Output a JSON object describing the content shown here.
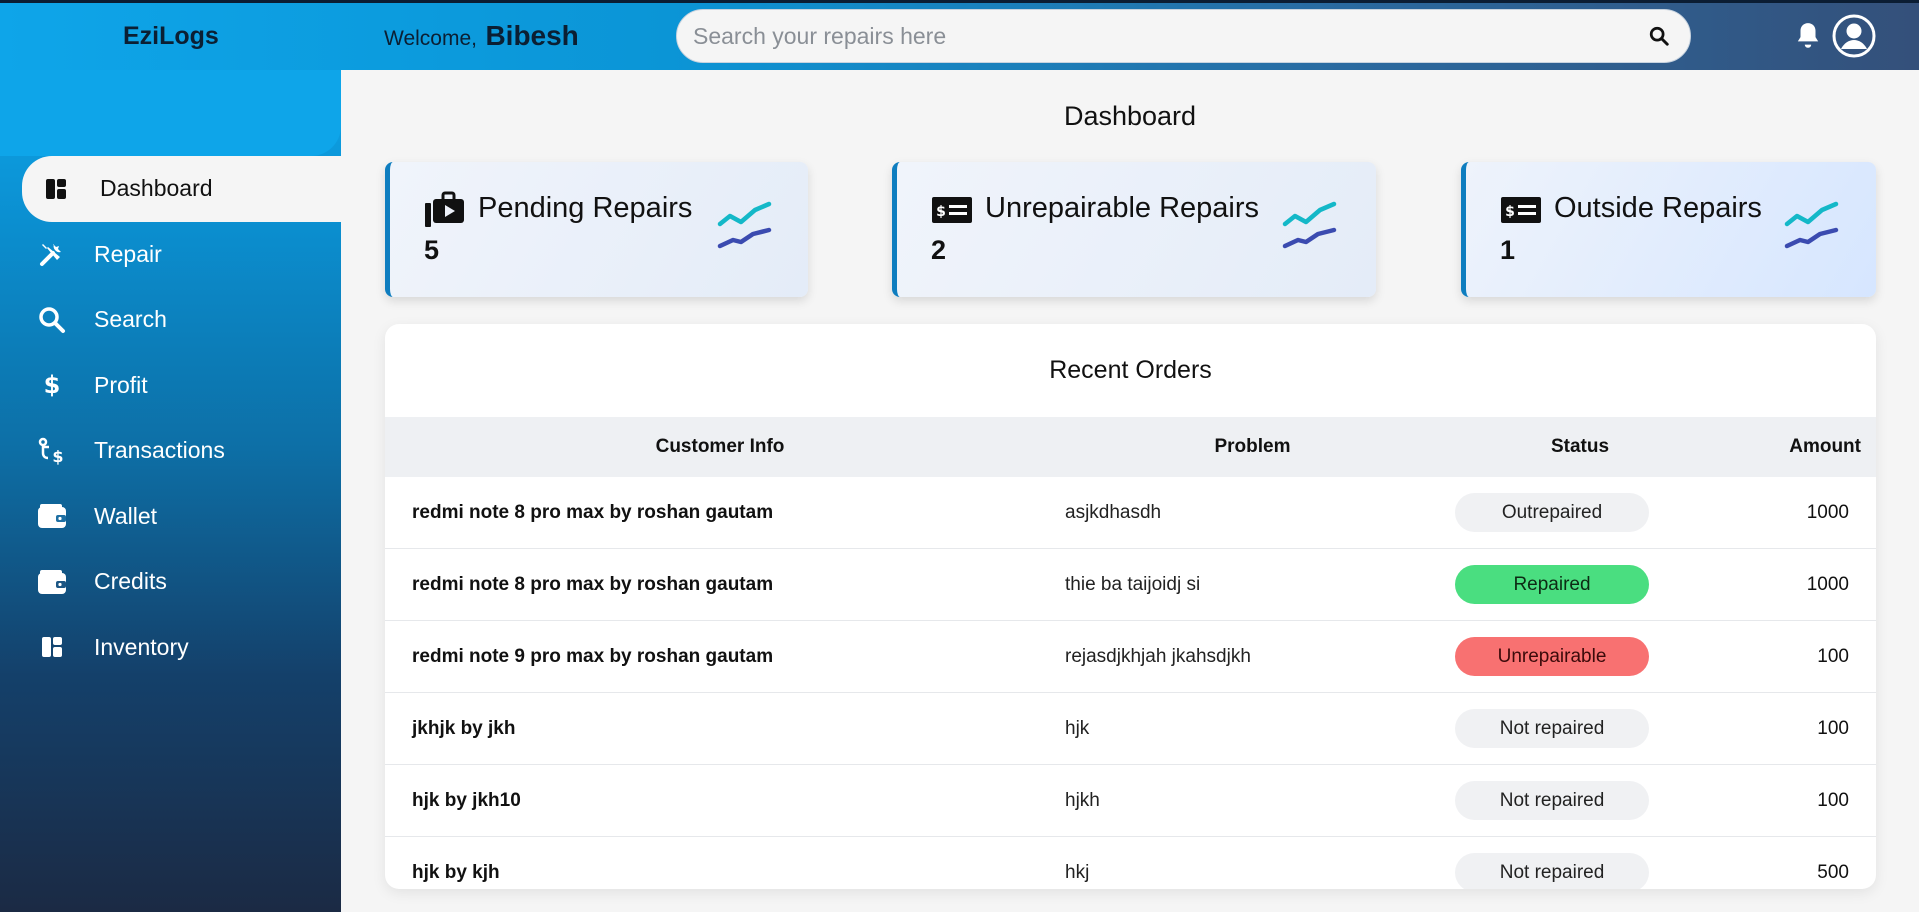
{
  "app": {
    "name": "EziLogs"
  },
  "header": {
    "welcome_label": "Welcome,",
    "user_name": "Bibesh",
    "search_placeholder": "Search your repairs here"
  },
  "sidebar": {
    "items": [
      {
        "label": "Dashboard",
        "icon": "dashboard-icon",
        "active": true
      },
      {
        "label": "Repair",
        "icon": "tools-icon"
      },
      {
        "label": "Search",
        "icon": "search-icon"
      },
      {
        "label": "Profit",
        "icon": "dollar-icon"
      },
      {
        "label": "Transactions",
        "icon": "transactions-icon"
      },
      {
        "label": "Wallet",
        "icon": "wallet-icon"
      },
      {
        "label": "Credits",
        "icon": "wallet-icon"
      },
      {
        "label": "Inventory",
        "icon": "inventory-icon"
      }
    ]
  },
  "main": {
    "title": "Dashboard",
    "cards": [
      {
        "label": "Pending Repairs",
        "value": "5",
        "icon": "briefcase-play-icon"
      },
      {
        "label": "Unrepairable Repairs",
        "value": "2",
        "icon": "money-card-icon"
      },
      {
        "label": "Outside Repairs",
        "value": "1",
        "icon": "money-card-icon"
      }
    ],
    "orders": {
      "title": "Recent Orders",
      "columns": [
        "Customer Info",
        "Problem",
        "Status",
        "Amount"
      ],
      "rows": [
        {
          "customer": "redmi note 8 pro max by roshan gautam",
          "problem": "asjkdhasdh",
          "status": "Outrepaired",
          "amount": "1000"
        },
        {
          "customer": "redmi note 8 pro max by roshan gautam",
          "problem": "thie ba taijoidj si",
          "status": "Repaired",
          "amount": "1000"
        },
        {
          "customer": "redmi note 9 pro max by roshan gautam",
          "problem": "rejasdjkhjah jkahsdjkh",
          "status": "Unrepairable",
          "amount": "100"
        },
        {
          "customer": "jkhjk by jkh",
          "problem": "hjk",
          "status": "Not repaired",
          "amount": "100"
        },
        {
          "customer": "hjk by jkh10",
          "problem": "hjkh",
          "status": "Not repaired",
          "amount": "100"
        },
        {
          "customer": "hjk by kjh",
          "problem": "hkj",
          "status": "Not repaired",
          "amount": "500"
        }
      ]
    }
  },
  "colors": {
    "accent": "#0ea5e9",
    "sidebar_dark": "#1b2a44",
    "repaired": "#4ade80",
    "unrepairable": "#f87171",
    "trend_top": "#14b8c8",
    "trend_bottom": "#3b4bb0"
  }
}
